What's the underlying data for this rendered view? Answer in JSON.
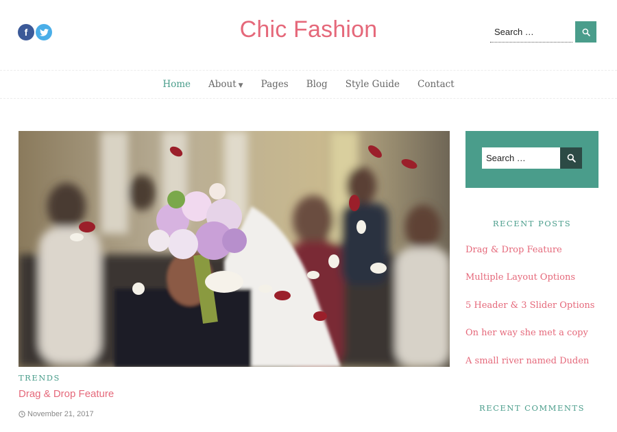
{
  "header": {
    "site_title": "Chic Fashion",
    "search_placeholder": "Search …",
    "social": [
      "facebook-icon",
      "twitter-icon"
    ],
    "social_glyph_facebook": "f"
  },
  "nav": {
    "items": [
      {
        "label": "Home",
        "active": true
      },
      {
        "label": "About",
        "has_dropdown": true
      },
      {
        "label": "Pages"
      },
      {
        "label": "Blog"
      },
      {
        "label": "Style Guide"
      },
      {
        "label": "Contact"
      }
    ]
  },
  "post": {
    "category": "TRENDS",
    "title": "Drag & Drop Feature",
    "date": "November 21, 2017",
    "image": "wedding-bouquet-photo"
  },
  "sidebar": {
    "search_placeholder": "Search …",
    "recent_posts_title": "RECENT POSTS",
    "recent_posts": [
      "Drag & Drop Feature",
      "Multiple Layout Options",
      "5 Header & 3 Slider Options",
      "On her way she met a copy",
      "A small river named Duden"
    ],
    "recent_comments_title": "RECENT COMMENTS"
  },
  "colors": {
    "accent": "#4a9d8b",
    "brand_pink": "#e5687a",
    "search_btn_dark": "#2c4a45"
  }
}
